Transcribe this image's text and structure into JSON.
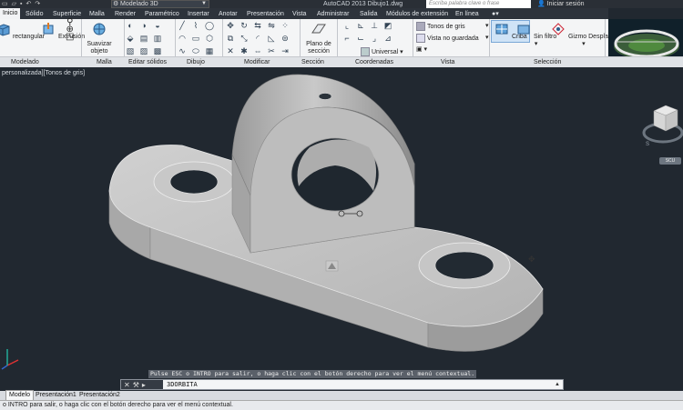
{
  "titlebar": {
    "workspace": "Modelado 3D",
    "app_title": "AutoCAD 2013   Dibujo1.dwg",
    "search_placeholder": "Escriba palabra clave o frase",
    "signin": "Iniciar sesión"
  },
  "ribbon_tabs": [
    "Inicio",
    "Sólido",
    "Superficie",
    "Malla",
    "Render",
    "Paramétrico",
    "Insertar",
    "Anotar",
    "Presentación",
    "Vista",
    "Administrar",
    "Salida",
    "Módulos de extensión",
    "En línea"
  ],
  "ribbon": {
    "buttons": {
      "rectangular": "rectangular",
      "extrusion": "Extrusión",
      "suavizar": "Suavizar objeto",
      "plano_seccion": "Plano de sección",
      "criba": "Criba",
      "sin_filtro": "Sin filtro",
      "gizmo": "Gizmo Desplazar"
    },
    "dropdowns": {
      "visual_style": "Tonos de gris",
      "view": "Vista no guardada",
      "coords": "Universal"
    },
    "panels": [
      "Modelado",
      "Malla",
      "Editar sólidos",
      "Dibujo",
      "Modificar",
      "Sección",
      "Coordenadas",
      "Vista",
      "Selección"
    ]
  },
  "viewport": {
    "label": "personalizada][Tonos de gris]",
    "wcs": "SCU"
  },
  "command": {
    "hint": "Pulse ESC o INTRO para salir, o haga clic con el botón derecho para ver el menú contextual.",
    "input": "3DORBITA"
  },
  "layout_tabs": [
    "Modelo",
    "Presentación1",
    "Presentación2"
  ],
  "status": "o INTRO para salir, o haga clic con el botón derecho para ver el menú contextual.",
  "colors": {
    "background": "#212830",
    "ribbon": "#f4f5f6",
    "model": "#b9b9b9"
  }
}
